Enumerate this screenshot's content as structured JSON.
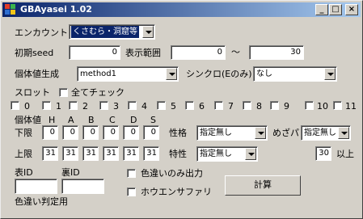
{
  "window": {
    "title": "GBAyasei  1.02",
    "minimize": "_",
    "maximize": "□",
    "close": "×"
  },
  "encounter": {
    "label": "エンカウント",
    "value": "くさむら・洞窟等"
  },
  "seed": {
    "label": "初期seed",
    "value": "0"
  },
  "range": {
    "label": "表示範囲",
    "from": "0",
    "sep": "～",
    "to": "30"
  },
  "method": {
    "label": "個体値生成",
    "value": "method1"
  },
  "synchro": {
    "label": "シンクロ(Eのみ)",
    "value": "なし"
  },
  "slot": {
    "label": "スロット",
    "check_all": "全てチェック",
    "items": [
      "0",
      "1",
      "2",
      "3",
      "4",
      "5",
      "6",
      "7",
      "8",
      "9",
      "10",
      "11"
    ]
  },
  "ivs": {
    "label": "個体値",
    "stats": [
      "H",
      "A",
      "B",
      "C",
      "D",
      "S"
    ],
    "lower_label": "下限",
    "upper_label": "上限",
    "lower": [
      "0",
      "0",
      "0",
      "0",
      "0",
      "0"
    ],
    "upper": [
      "31",
      "31",
      "31",
      "31",
      "31",
      "31"
    ]
  },
  "nature": {
    "label": "性格",
    "value": "指定無し"
  },
  "hidden_power": {
    "label": "めざパ",
    "value": "指定無し"
  },
  "characteristic": {
    "label": "特性",
    "value": "指定無し"
  },
  "hp_power": {
    "value": "30",
    "suffix": "以上"
  },
  "tid": {
    "label": "表ID",
    "value": ""
  },
  "sid": {
    "label": "裏ID",
    "value": ""
  },
  "shiny_note": "色違い判定用",
  "shiny_only": "色違いのみ出力",
  "hoenn_safari": "ホウエンサファリ",
  "calc_button": "計算"
}
